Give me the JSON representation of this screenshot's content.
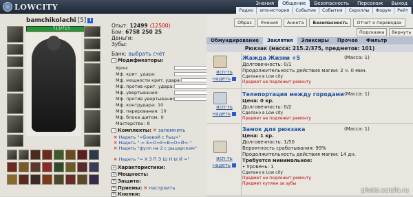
{
  "app": {
    "logo_text": "LOWCITY"
  },
  "top_menu": {
    "items": [
      "Знания",
      "Общение",
      "Безопасность",
      "Персонаж",
      "Выход"
    ],
    "active": "Общение"
  },
  "sub_menu": {
    "items": [
      "Радио",
      "sms-история",
      "Событие",
      "События",
      "Скроллы",
      "Форум",
      "Рейт"
    ]
  },
  "character": {
    "name": "bamchikolachi",
    "level": "[5]",
    "info_icon": "i",
    "hp_text": "713/713",
    "hp_fraction": 1.0
  },
  "stats": {
    "exp_label": "Опыт:",
    "exp_value": "12499",
    "exp_next": "(12500)",
    "battles_label": "Бои:",
    "battles_value": "6758",
    "battles_extra": "250",
    "battles_extra2": "25",
    "money_label": "Деньги:",
    "teeth_label": "Зубы:",
    "bank_label": "Банк:",
    "bank_link": "выбрать счёт"
  },
  "modifiers": {
    "header": "Модификаторы:",
    "rows": [
      {
        "label": "Урон:",
        "value": ""
      },
      {
        "label": "Мф. крит. удара:",
        "value": ""
      },
      {
        "label": "Мф. мощности крит. удара:",
        "value": ""
      },
      {
        "label": "Мф. против крит. удара:",
        "value": ""
      },
      {
        "label": "Мф. увертывания:",
        "value": ""
      },
      {
        "label": "Мф. против увертывания:",
        "value": ""
      },
      {
        "label": "Мф. контрудара:",
        "value": "10"
      },
      {
        "label": "Мф. парирования:",
        "value": "10"
      },
      {
        "label": "Мф. блока щитом:",
        "value": "0"
      },
      {
        "label": "Мастерство:",
        "value": "8"
      }
    ]
  },
  "kits": {
    "header": "Комплекты:",
    "remember": "запомнить",
    "items": [
      "Надеть \"=БоевоЙ с Рыц=\"",
      "Надеть \"-= Б=О=Е=В=О=Й=-\"",
      "Надеть \"фулл на 2 с рыцарским\"",
      "Надеть \"= Х З П Э Ш Н Ы Й =\""
    ]
  },
  "sections": {
    "characteristics": "Характеристики:",
    "power": "Мощность:",
    "defense": "Защита:",
    "techniques": "Приемы:",
    "configure": "настроить",
    "buttons": "Кнопки:"
  },
  "right_buttons": [
    "Образ",
    "Умения",
    "Анкета",
    "Безопасность",
    "Отчет о переводах"
  ],
  "right_buttons2": [
    "Подсказка",
    "Вернуть"
  ],
  "tabs": [
    "Обмундирование",
    "Заклятия",
    "Эликсиры",
    "Прочее",
    "Фильтр"
  ],
  "active_tab": "Заклятия",
  "rucksack_title": "Рюкзак (масса: 215.2/375, предметов: 101)",
  "items": [
    {
      "action": "исп-ть",
      "wear": "надеть",
      "name": "Жажда Жизни +5",
      "mass": "(Масса: 1)",
      "lines": [
        "Долговечность: 0/1",
        "Продолжительность действия магии: 2 ч. 0 мин.",
        "Сделано в Low city"
      ],
      "note": "Предмет не подлежит ремонту"
    },
    {
      "action": "исп-ть",
      "wear": "надеть",
      "name": "Телепортация между городами",
      "mass": "(Масса: 1)",
      "lines": [
        "Цена: 0 кр.",
        "Долговечность: 0/2",
        "Сделано в Low city"
      ],
      "note": "Предмет не подлежит ремонту"
    },
    {
      "action": "исп-ть",
      "wear": "надеть",
      "name": "Замок для рюкзака",
      "mass": "(Масса: 1)",
      "lines": [
        "Цена: 1 кр.",
        "Долговечность: 1/50",
        "Вероятность срабатывания: 99%",
        "Продолжительность действия магии: 14 дн.",
        "Требуется минимальное:",
        "• Уровень: 1",
        "Сделано в Low city"
      ],
      "note": "Предмет не подлежит ремонту",
      "note2": "Предмет куплен за зубы"
    }
  ],
  "watermark": "photo.scrolls.ru"
}
